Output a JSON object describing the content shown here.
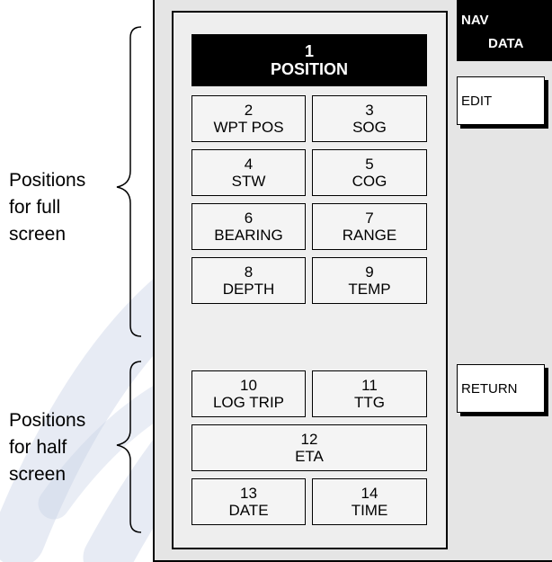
{
  "labels": {
    "full": "Positions\nfor full\nscreen",
    "half": "Positions\nfor half\nscreen"
  },
  "softkeys": {
    "nav_data_line1": "NAV",
    "nav_data_line2": "DATA",
    "edit": "EDIT",
    "return": "RETURN"
  },
  "cells": {
    "c1": {
      "num": "1",
      "name": "POSITION"
    },
    "c2": {
      "num": "2",
      "name": "WPT POS"
    },
    "c3": {
      "num": "3",
      "name": "SOG"
    },
    "c4": {
      "num": "4",
      "name": "STW"
    },
    "c5": {
      "num": "5",
      "name": "COG"
    },
    "c6": {
      "num": "6",
      "name": "BEARING"
    },
    "c7": {
      "num": "7",
      "name": "RANGE"
    },
    "c8": {
      "num": "8",
      "name": "DEPTH"
    },
    "c9": {
      "num": "9",
      "name": "TEMP"
    },
    "c10": {
      "num": "10",
      "name": "LOG TRIP"
    },
    "c11": {
      "num": "11",
      "name": "TTG"
    },
    "c12": {
      "num": "12",
      "name": "ETA"
    },
    "c13": {
      "num": "13",
      "name": "DATE"
    },
    "c14": {
      "num": "14",
      "name": "TIME"
    }
  },
  "colors": {
    "watermark_orange": "#f7c98a",
    "watermark_blue": "#c9d3e6",
    "panel_gray": "#e5e5e5"
  }
}
